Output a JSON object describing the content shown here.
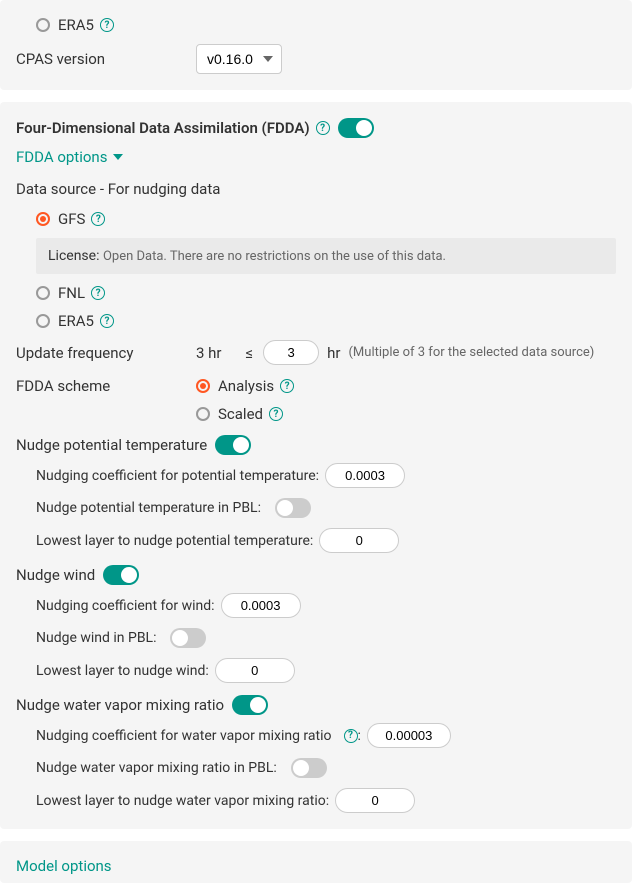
{
  "top": {
    "era5_label": "ERA5",
    "cpas_label": "CPAS version",
    "cpas_value": "v0.16.0"
  },
  "fdda": {
    "title": "Four-Dimensional Data Assimilation (FDDA)",
    "options_link": "FDDA options",
    "data_source_label": "Data source - For nudging data",
    "sources": {
      "gfs": "GFS",
      "fnl": "FNL",
      "era5": "ERA5"
    },
    "license_label": "License:",
    "license_text": "Open Data. There are no restrictions on the use of this data.",
    "update_freq_label": "Update frequency",
    "update_freq_fixed": "3 hr",
    "update_freq_op": "≤",
    "update_freq_value": "3",
    "update_freq_unit": "hr",
    "update_freq_hint": "(Multiple of 3 for the selected data source)",
    "scheme_label": "FDDA scheme",
    "scheme_analysis": "Analysis",
    "scheme_scaled": "Scaled"
  },
  "nudge_temp": {
    "title": "Nudge potential temperature",
    "coef_label": "Nudging coefficient for potential temperature:",
    "coef_value": "0.0003",
    "pbl_label": "Nudge potential temperature in PBL:",
    "lowest_label": "Lowest layer to nudge potential temperature:",
    "lowest_value": "0"
  },
  "nudge_wind": {
    "title": "Nudge wind",
    "coef_label": "Nudging coefficient for wind:",
    "coef_value": "0.0003",
    "pbl_label": "Nudge wind in PBL:",
    "lowest_label": "Lowest layer to nudge wind:",
    "lowest_value": "0"
  },
  "nudge_vapor": {
    "title": "Nudge water vapor mixing ratio",
    "coef_label": "Nudging coefficient for water vapor mixing ratio",
    "coef_value": "0.00003",
    "pbl_label": "Nudge water vapor mixing ratio in PBL:",
    "lowest_label": "Lowest layer to nudge water vapor mixing ratio:",
    "lowest_value": "0"
  },
  "bottom": {
    "model_options": "Model options"
  }
}
